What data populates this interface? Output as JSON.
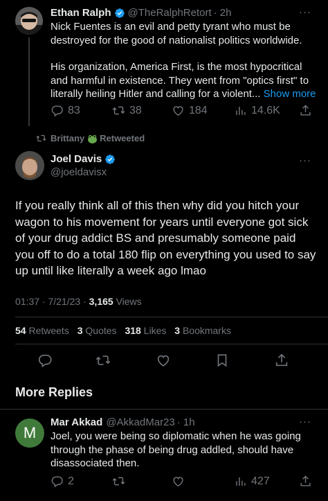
{
  "tweet1": {
    "name": "Ethan Ralph",
    "handle": "@TheRalphRetort",
    "time": "· 2h",
    "more": "···",
    "paragraph1": "Nick Fuentes is an evil and petty tyrant who must be destroyed for the good of nationalist politics worldwide.",
    "paragraph2": "His organization, America First, is the most hypocritical and harmful in existence. They went from \"optics first\" to literally heiling Hitler and calling for a violent...",
    "show_more": " Show more",
    "replies": "83",
    "retweets": "38",
    "likes": "184",
    "views": "14.6K"
  },
  "retweet_bar": {
    "user": "Brittany",
    "suffix": "Retweeted"
  },
  "tweet2": {
    "name": "Joel Davis",
    "handle": "@joeldavisx",
    "more": "···",
    "text": "If you really think all of this then why did you hitch your wagon to his movement for years until everyone got sick of your drug addict BS and presumably someone paid you off to do a total 180 flip on everything you used to say up until like literally a week ago lmao",
    "timestamp": "01:37 · 7/21/23 · ",
    "view_count": "3,165",
    "views_label": " Views",
    "retweets_count": "54",
    "retweets_label": " Retweets",
    "quotes_count": "3",
    "quotes_label": " Quotes",
    "likes_count": "318",
    "likes_label": " Likes",
    "bookmarks_count": "3",
    "bookmarks_label": " Bookmarks"
  },
  "more_replies": "More Replies",
  "reply": {
    "avatar_letter": "M",
    "avatar_color": "#3f7a3a",
    "name": "Mar Akkad",
    "handle": "@AkkadMar23",
    "time": "· 1h",
    "more": "···",
    "text": "Joel, you were being so diplomatic when he was going through the phase of being drug addled, should have disassociated then.",
    "replies": "2",
    "views": "427"
  },
  "colors": {
    "background": "#000000",
    "text": "#e7e9ea",
    "muted": "#71767b",
    "accent": "#1d9bf0",
    "divider": "#2f3336"
  },
  "icons": [
    "verified-badge-icon",
    "reply-icon",
    "retweet-icon",
    "like-icon",
    "views-icon",
    "share-icon",
    "bookmark-icon",
    "more-icon"
  ]
}
